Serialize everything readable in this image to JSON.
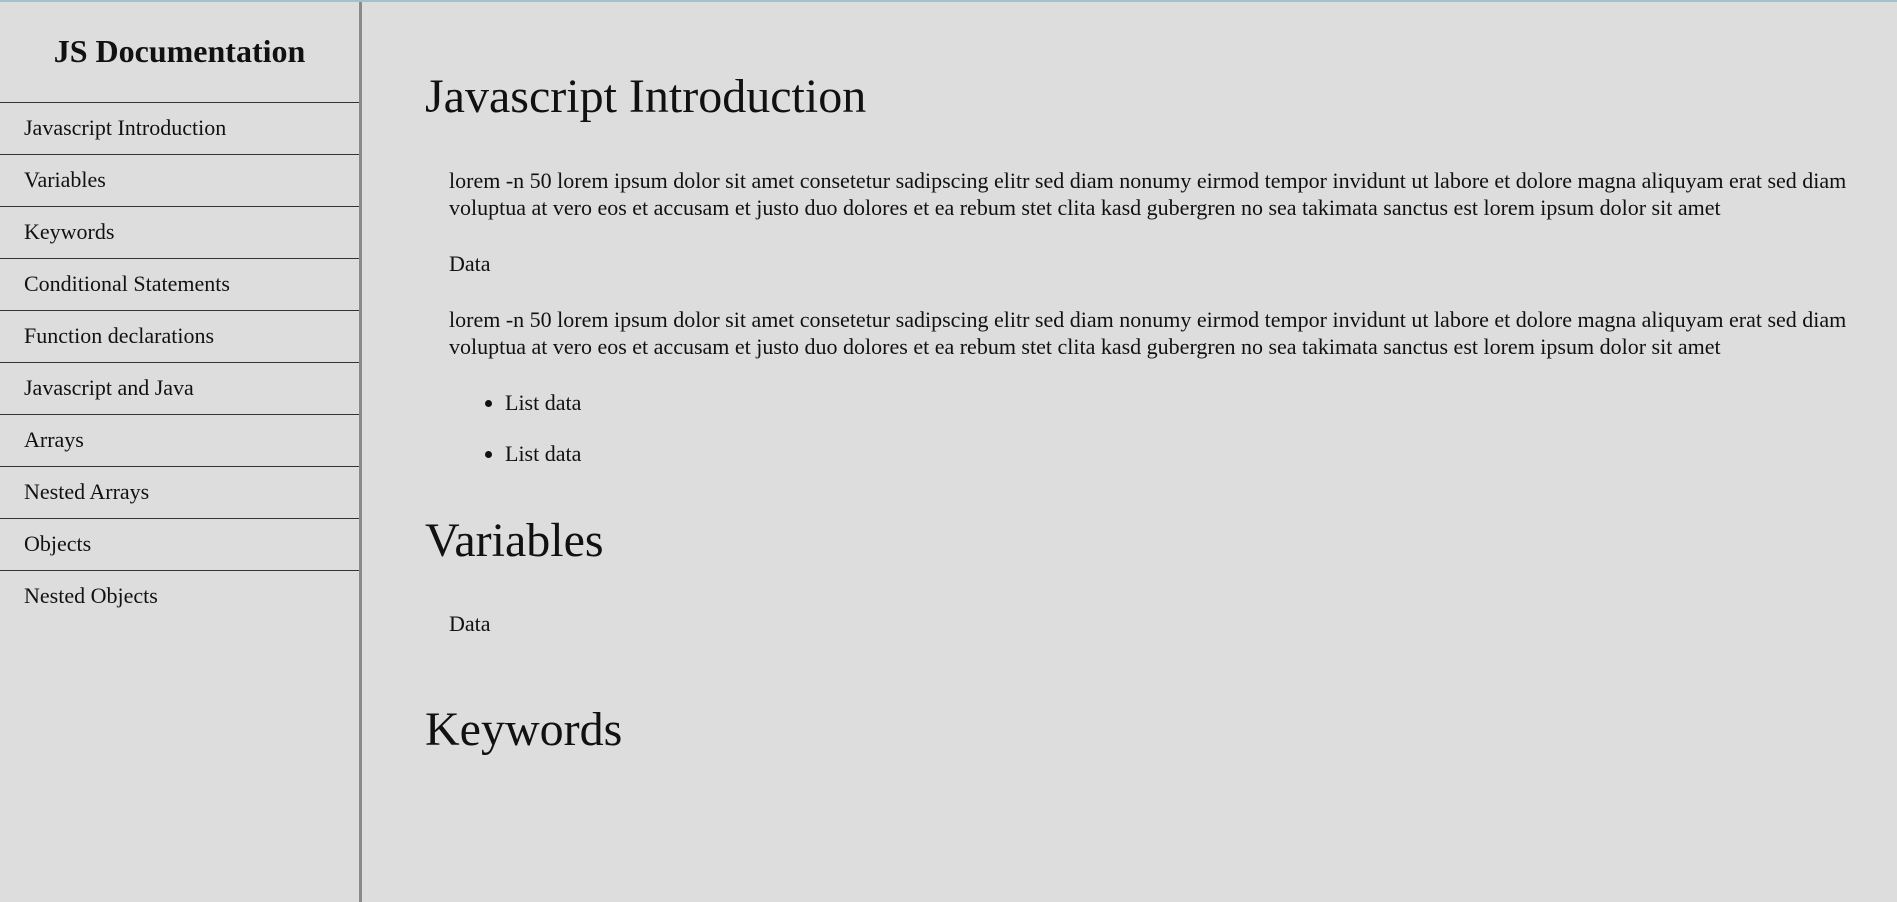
{
  "navbar": {
    "title": "JS Documentation",
    "items": [
      "Javascript Introduction",
      "Variables",
      "Keywords",
      "Conditional Statements",
      "Function declarations",
      "Javascript and Java",
      "Arrays",
      "Nested Arrays",
      "Objects",
      "Nested Objects"
    ]
  },
  "sections": [
    {
      "title": "Javascript Introduction",
      "paragraphs": [
        "lorem -n 50 lorem ipsum dolor sit amet consetetur sadipscing elitr sed diam nonumy eirmod tempor invidunt ut labore et dolore magna aliquyam erat sed diam voluptua at vero eos et accusam et justo duo dolores et ea rebum stet clita kasd gubergren no sea takimata sanctus est lorem ipsum dolor sit amet",
        "Data",
        "lorem -n 50 lorem ipsum dolor sit amet consetetur sadipscing elitr sed diam nonumy eirmod tempor invidunt ut labore et dolore magna aliquyam erat sed diam voluptua at vero eos et accusam et justo duo dolores et ea rebum stet clita kasd gubergren no sea takimata sanctus est lorem ipsum dolor sit amet"
      ],
      "list": [
        "List data",
        "List data"
      ]
    },
    {
      "title": "Variables",
      "paragraphs": [
        "Data"
      ]
    },
    {
      "title": "Keywords"
    }
  ]
}
